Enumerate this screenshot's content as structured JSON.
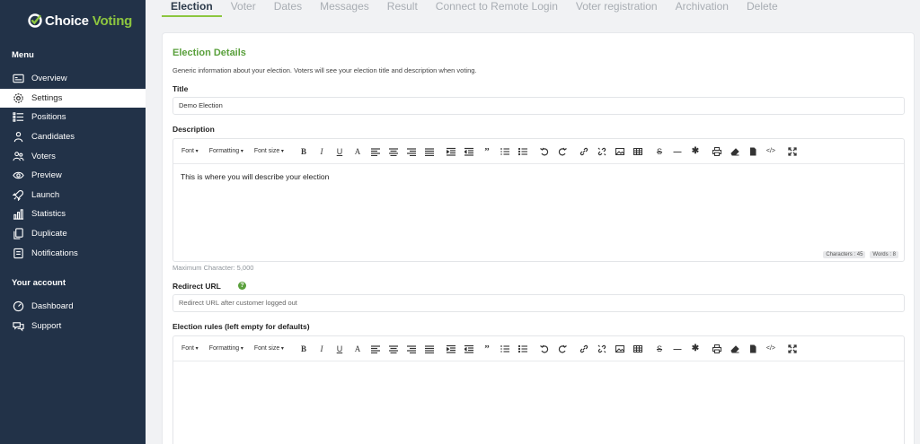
{
  "brand": {
    "name_prefix": "Choice",
    "name_suffix": "Voting",
    "accent": "#8dc63f"
  },
  "sidebar": {
    "menu_heading": "Menu",
    "items": [
      {
        "label": "Overview",
        "icon": "overview-icon"
      },
      {
        "label": "Settings",
        "icon": "gear-icon",
        "active": true
      },
      {
        "label": "Positions",
        "icon": "list-icon"
      },
      {
        "label": "Candidates",
        "icon": "candidates-icon"
      },
      {
        "label": "Voters",
        "icon": "voters-icon"
      },
      {
        "label": "Preview",
        "icon": "eye-icon"
      },
      {
        "label": "Launch",
        "icon": "rocket-icon"
      },
      {
        "label": "Statistics",
        "icon": "chart-icon"
      },
      {
        "label": "Duplicate",
        "icon": "duplicate-icon"
      },
      {
        "label": "Notifications",
        "icon": "bell-icon"
      }
    ],
    "account_heading": "Your account",
    "account_items": [
      {
        "label": "Dashboard",
        "icon": "dashboard-icon"
      },
      {
        "label": "Support",
        "icon": "support-icon"
      }
    ]
  },
  "tabs": [
    "Election",
    "Voter",
    "Dates",
    "Messages",
    "Result",
    "Connect to Remote Login",
    "Voter registration",
    "Archivation",
    "Delete"
  ],
  "card": {
    "title": "Election Details",
    "description": "Generic information about your election. Voters will see your election title and description when voting.",
    "title_label": "Title",
    "title_value": "Demo Election",
    "description_label": "Description",
    "description_text": "This is where you will describe your election",
    "characters": "Characters : 45",
    "words": "Words : 8",
    "max_chars": "Maximum Character: 5,000",
    "redirect_label": "Redirect URL",
    "redirect_placeholder": "Redirect URL after customer logged out",
    "rules_label": "Election rules (left empty for defaults)"
  },
  "toolbar": {
    "font": "Font",
    "formatting": "Formatting",
    "font_size": "Font size"
  }
}
